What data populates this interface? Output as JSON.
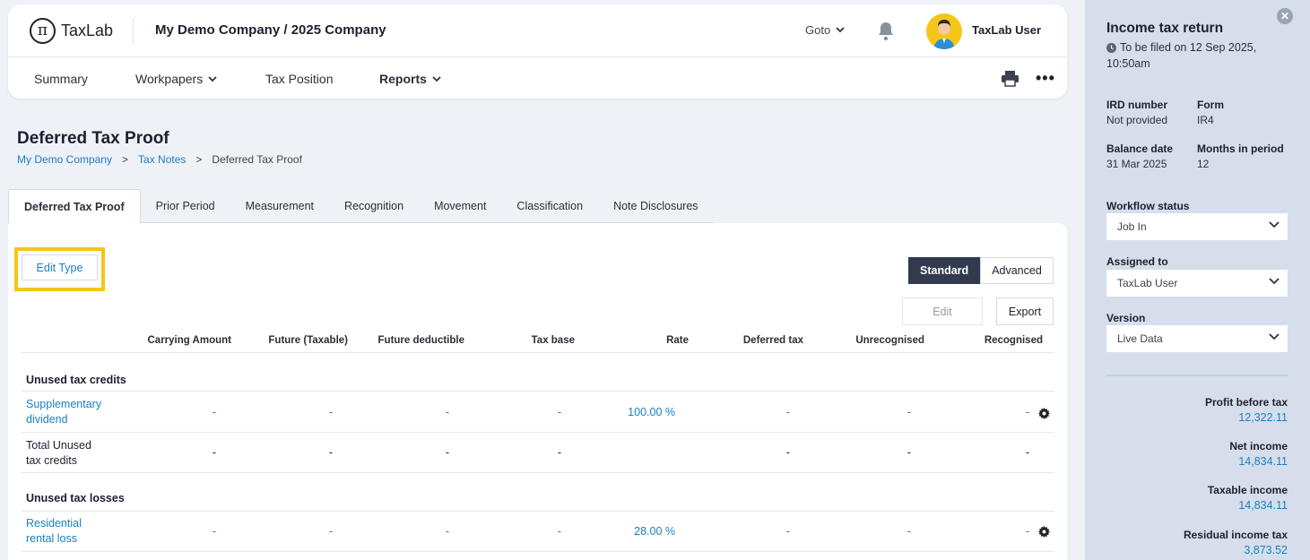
{
  "header": {
    "logo_text": "TaxLab",
    "company": "My Demo Company / 2025 Company",
    "goto_label": "Goto",
    "user_name": "TaxLab User"
  },
  "nav": {
    "summary": "Summary",
    "workpapers": "Workpapers",
    "tax_position": "Tax Position",
    "reports": "Reports"
  },
  "page": {
    "title": "Deferred Tax Proof",
    "breadcrumb": [
      "My Demo Company",
      "Tax Notes",
      "Deferred Tax Proof"
    ]
  },
  "tabs": [
    "Deferred Tax Proof",
    "Prior Period",
    "Measurement",
    "Recognition",
    "Movement",
    "Classification",
    "Note Disclosures"
  ],
  "toolbar": {
    "edit_type": "Edit Type",
    "standard": "Standard",
    "advanced": "Advanced",
    "edit": "Edit",
    "export": "Export"
  },
  "table": {
    "columns": [
      "Carrying Amount",
      "Future (Taxable)",
      "Future deductible",
      "Tax base",
      "Rate",
      "Deferred tax",
      "Unrecognised",
      "Recognised"
    ],
    "sections": [
      {
        "title": "Unused tax credits",
        "rows": [
          {
            "name": [
              "Supplementary",
              "dividend"
            ],
            "values": [
              "-",
              "-",
              "-",
              "-",
              "100.00 %",
              "-",
              "-",
              "-"
            ]
          },
          {
            "name": [
              "Total Unused",
              "tax credits"
            ],
            "values": [
              "-",
              "-",
              "-",
              "-",
              "",
              "-",
              "-",
              "-"
            ]
          }
        ]
      },
      {
        "title": "Unused tax losses",
        "rows": [
          {
            "name": [
              "Residential",
              "rental loss"
            ],
            "values": [
              "-",
              "-",
              "-",
              "-",
              "28.00 %",
              "-",
              "-",
              "-"
            ]
          }
        ]
      }
    ]
  },
  "side": {
    "title": "Income tax return",
    "due_line1": "To be filed on 12 Sep 2025,",
    "due_line2": "10:50am",
    "ird_label": "IRD number",
    "ird_value": "Not provided",
    "form_label": "Form",
    "form_value": "IR4",
    "balance_label": "Balance date",
    "balance_value": "31 Mar 2025",
    "months_label": "Months in period",
    "months_value": "12",
    "workflow_label": "Workflow status",
    "workflow_value": "Job In",
    "assigned_label": "Assigned to",
    "assigned_value": "TaxLab User",
    "version_label": "Version",
    "version_value": "Live Data",
    "metrics": [
      {
        "label": "Profit before tax",
        "value": "12,322.11"
      },
      {
        "label": "Net income",
        "value": "14,834.11"
      },
      {
        "label": "Taxable income",
        "value": "14,834.11"
      },
      {
        "label": "Residual income tax",
        "value": "3,873.52"
      }
    ]
  },
  "colors": {
    "accent": "#1a7fc4",
    "highlight": "#f5c518",
    "dark": "#323a4f",
    "side_bg": "#d5deea"
  }
}
